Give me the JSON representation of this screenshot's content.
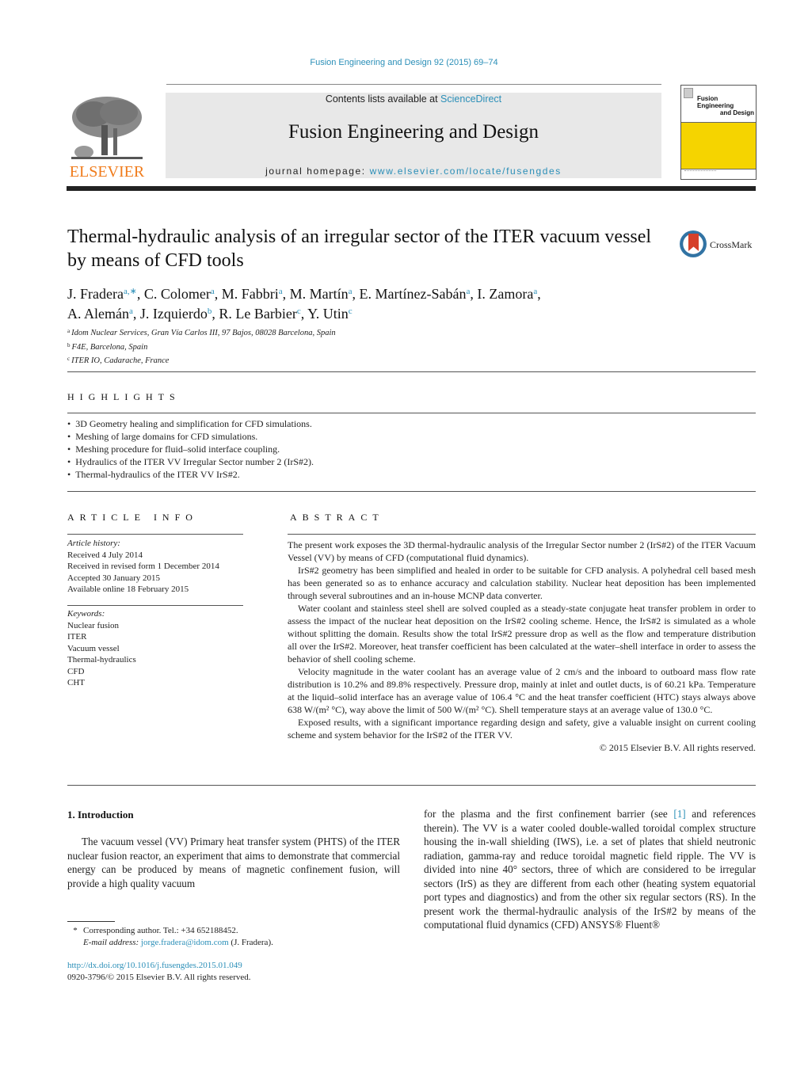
{
  "header": {
    "citation": "Fusion Engineering and Design 92 (2015) 69–74",
    "contents_prefix": "Contents lists available at ",
    "contents_link": "ScienceDirect",
    "journal_name": "Fusion Engineering and Design",
    "homepage_prefix": "journal homepage: ",
    "homepage_link": "www.elsevier.com/locate/fusengdes",
    "publisher_logo_text": "ELSEVIER",
    "cover_title_line1": "Fusion Engineering",
    "cover_title_line2": "and Design",
    "brand_orange": "#f07c1c",
    "cover_yellow": "#f5d400",
    "link_color": "#2b8fb8"
  },
  "article": {
    "title": "Thermal-hydraulic analysis of an irregular sector of the ITER vacuum vessel by means of CFD tools",
    "crossmark_label": "CrossMark",
    "authors": [
      {
        "name": "J. Fradera",
        "aff": "a,∗"
      },
      {
        "name": "C. Colomer",
        "aff": "a"
      },
      {
        "name": "M. Fabbri",
        "aff": "a"
      },
      {
        "name": "M. Martín",
        "aff": "a"
      },
      {
        "name": "E. Martínez-Sabán",
        "aff": "a"
      },
      {
        "name": "I. Zamora",
        "aff": "a"
      },
      {
        "name": "A. Alemán",
        "aff": "a"
      },
      {
        "name": "J. Izquierdo",
        "aff": "b"
      },
      {
        "name": "R. Le Barbier",
        "aff": "c"
      },
      {
        "name": "Y. Utin",
        "aff": "c"
      }
    ],
    "affiliations": [
      {
        "key": "a",
        "text": "Idom Nuclear Services, Gran Vía Carlos III, 97 Bajos, 08028 Barcelona, Spain"
      },
      {
        "key": "b",
        "text": "F4E, Barcelona, Spain"
      },
      {
        "key": "c",
        "text": "ITER IO, Cadarache, France"
      }
    ]
  },
  "highlights": {
    "heading": "HIGHLIGHTS",
    "items": [
      "3D Geometry healing and simplification for CFD simulations.",
      "Meshing of large domains for CFD simulations.",
      "Meshing procedure for fluid–solid interface coupling.",
      "Hydraulics of the ITER VV Irregular Sector number 2 (IrS#2).",
      "Thermal-hydraulics of the ITER VV IrS#2."
    ]
  },
  "article_info": {
    "heading": "ARTICLE INFO",
    "history_label": "Article history:",
    "history": [
      "Received 4 July 2014",
      "Received in revised form 1 December 2014",
      "Accepted 30 January 2015",
      "Available online 18 February 2015"
    ],
    "keywords_label": "Keywords:",
    "keywords": [
      "Nuclear fusion",
      "ITER",
      "Vacuum vessel",
      "Thermal-hydraulics",
      "CFD",
      "CHT"
    ]
  },
  "abstract": {
    "heading": "ABSTRACT",
    "paragraphs": [
      "The present work exposes the 3D thermal-hydraulic analysis of the Irregular Sector number 2 (IrS#2) of the ITER Vacuum Vessel (VV) by means of CFD (computational fluid dynamics).",
      "IrS#2 geometry has been simplified and healed in order to be suitable for CFD analysis. A polyhedral cell based mesh has been generated so as to enhance accuracy and calculation stability. Nuclear heat deposition has been implemented through several subroutines and an in-house MCNP data converter.",
      "Water coolant and stainless steel shell are solved coupled as a steady-state conjugate heat transfer problem in order to assess the impact of the nuclear heat deposition on the IrS#2 cooling scheme. Hence, the IrS#2 is simulated as a whole without splitting the domain. Results show the total IrS#2 pressure drop as well as the flow and temperature distribution all over the IrS#2. Moreover, heat transfer coefficient has been calculated at the water–shell interface in order to assess the behavior of shell cooling scheme.",
      "Velocity magnitude in the water coolant has an average value of 2 cm/s and the inboard to outboard mass flow rate distribution is 10.2% and 89.8% respectively. Pressure drop, mainly at inlet and outlet ducts, is of 60.21 kPa. Temperature at the liquid–solid interface has an average value of 106.4 °C and the heat transfer coefficient (HTC) stays always above 638 W/(m² °C), way above the limit of 500 W/(m² °C). Shell temperature stays at an average value of 130.0 °C.",
      "Exposed results, with a significant importance regarding design and safety, give a valuable insight on current cooling scheme and system behavior for the IrS#2 of the ITER VV."
    ],
    "copyright": "© 2015 Elsevier B.V. All rights reserved."
  },
  "introduction": {
    "heading": "1.  Introduction",
    "left_text": "The vacuum vessel (VV) Primary heat transfer system (PHTS) of the ITER nuclear fusion reactor, an experiment that aims to demonstrate that commercial energy can be produced by means of magnetic confinement fusion, will provide a high quality vacuum",
    "right_text_1": "for the plasma and the first confinement barrier (see ",
    "right_ref": "[1]",
    "right_text_2": " and references therein). The VV is a water cooled double-walled toroidal complex structure housing the in-wall shielding (IWS), i.e. a set of plates that shield neutronic radiation, gamma-ray and reduce toroidal magnetic field ripple. The VV is divided into nine 40° sectors, three of which are considered to be irregular sectors (IrS) as they are different from each other (heating system equatorial port types and diagnostics) and from the other six regular sectors (RS). In the present work the thermal-hydraulic analysis of the IrS#2 by means of the computational fluid dynamics (CFD) ANSYS® Fluent®"
  },
  "footnotes": {
    "star": "*",
    "corresponding": "Corresponding author. Tel.: +34 652188452.",
    "email_label": "E-mail address: ",
    "email": "jorge.fradera@idom.com",
    "email_suffix": " (J. Fradera).",
    "doi": "http://dx.doi.org/10.1016/j.fusengdes.2015.01.049",
    "issn_copyright": "0920-3796/© 2015 Elsevier B.V. All rights reserved."
  }
}
